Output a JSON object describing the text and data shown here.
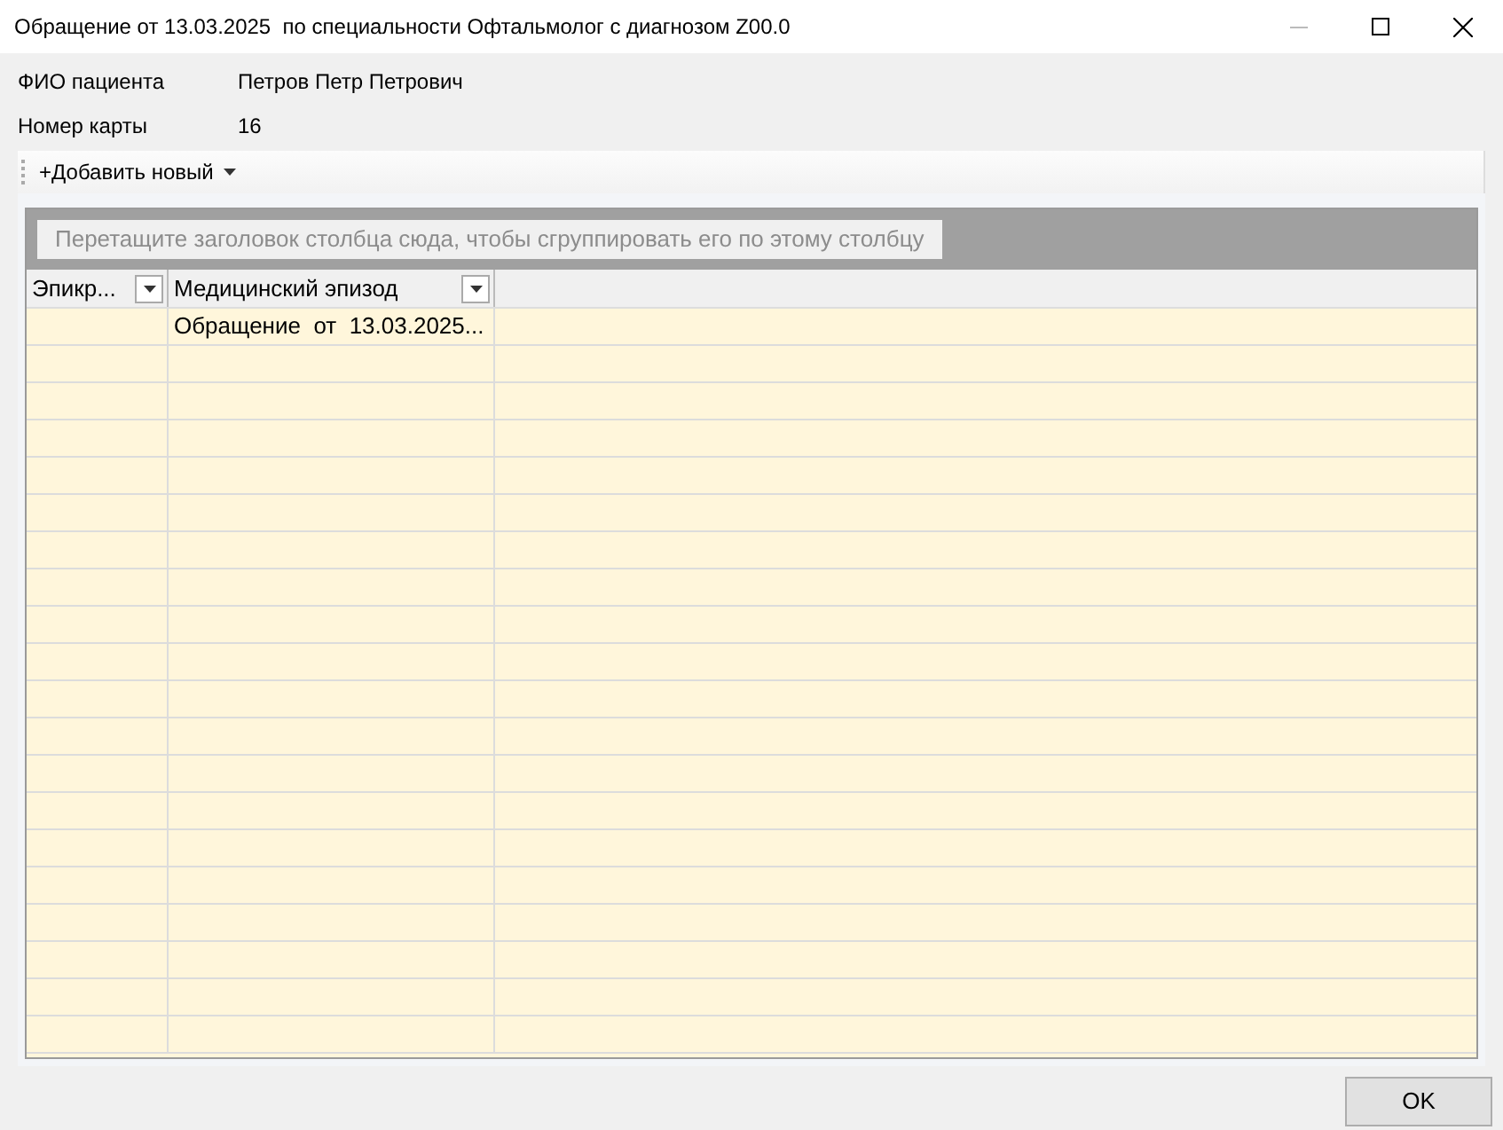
{
  "window": {
    "title": "Обращение от 13.03.2025  по специальности Офтальмолог с диагнозом Z00.0",
    "minimize_disabled": true
  },
  "fields": [
    {
      "label": "ФИО пациента",
      "value": "Петров Петр Петрович"
    },
    {
      "label": "Номер карты",
      "value": "16"
    }
  ],
  "toolbar": {
    "add_button": "+Добавить новый"
  },
  "grid": {
    "group_hint": "Перетащите заголовок столбца сюда, чтобы сгруппировать его по этому столбцу",
    "columns": [
      "Эпикр...",
      "Медицинский эпизод"
    ],
    "rows": [
      {
        "cells": [
          "",
          "Обращение  от  13.03.2025..."
        ]
      }
    ]
  },
  "buttons": [
    "OK"
  ]
}
